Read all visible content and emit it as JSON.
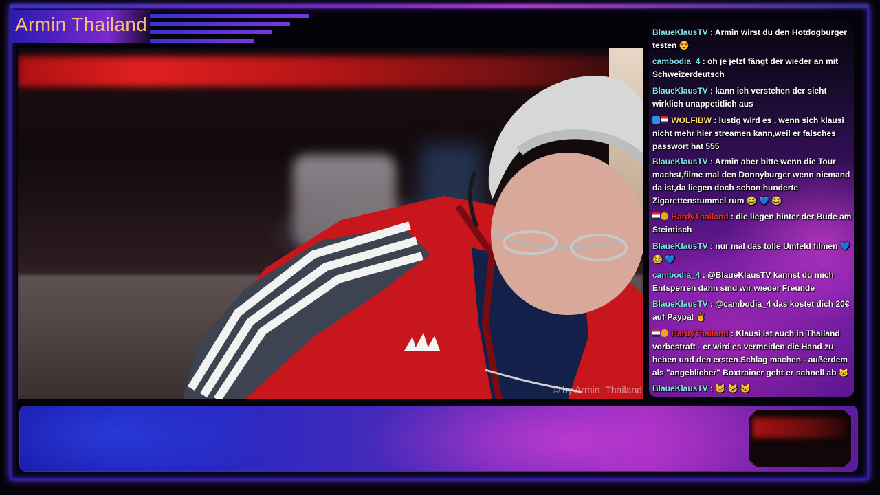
{
  "stream": {
    "title": "Armin Thailand",
    "watermark": "© by Armin_Thailand",
    "accent_colors": {
      "frame": "#2a1f9c",
      "title": "#f5c07a",
      "chat_bg": "#7a1fa8"
    }
  },
  "chat": {
    "messages": [
      {
        "user": "BlaueKlausTV",
        "user_color": "#7fe3e7",
        "badges": [],
        "text": "Armin wirst du den Hotdogburger testen",
        "emotes": "😍"
      },
      {
        "user": "cambodia_4",
        "user_color": "#7fe3e7",
        "badges": [],
        "text": "oh je jetzt fängt der wieder an mit Schweizerdeutsch",
        "emotes": ""
      },
      {
        "user": "BlaueKlausTV",
        "user_color": "#7fe3e7",
        "badges": [],
        "text": "kann ich verstehen der sieht wirklich unappetitlich aus",
        "emotes": ""
      },
      {
        "user": "WOLFIBW",
        "user_color": "#ffe36a",
        "badges": [
          "sub",
          "flag"
        ],
        "text": "lustig wird es , wenn sich klausi nicht mehr hier streamen kann,weil er falsches passwort hat 555",
        "emotes": ""
      },
      {
        "user": "BlaueKlausTV",
        "user_color": "#7fe3e7",
        "badges": [],
        "text": "Armin aber bitte wenn die Tour machst,filme mal den Donnyburger wenn niemand da ist,da liegen doch schon hunderte Zigarettenstummel rum",
        "emotes": "😂 💙 😂"
      },
      {
        "user": "HardyThailand",
        "user_color": "#e0302a",
        "badges": [
          "flag",
          "warn"
        ],
        "text": "die liegen hinter der Bude am Steintisch",
        "emotes": ""
      },
      {
        "user": "BlaueKlausTV",
        "user_color": "#7fe3e7",
        "badges": [],
        "text": "nur mal das tolle Umfeld filmen",
        "emotes": "💙 😂 💙"
      },
      {
        "user": "cambodia_4",
        "user_color": "#7fe3e7",
        "badges": [],
        "text": "@BlaueKlausTV kannst du mich Entsperren dann sind wir wieder Freunde",
        "emotes": ""
      },
      {
        "user": "BlaueKlausTV",
        "user_color": "#7fe3e7",
        "badges": [],
        "text": "@cambodia_4 das kostet dich 20€ auf Paypal",
        "emotes": "✌"
      },
      {
        "user": "HardyThailand",
        "user_color": "#e0302a",
        "badges": [
          "flag",
          "warn"
        ],
        "text": "Klausi ist auch in Thailand vorbestraft - er wird es vermeiden die Hand zu heben und den ersten Schlag machen - außerdem als \"angeblicher\" Boxtrainer geht er schnell ab",
        "emotes": "🐱"
      },
      {
        "user": "BlaueKlausTV",
        "user_color": "#7fe3e7",
        "badges": [],
        "text": "",
        "emotes": "🐱 🐱 🐱"
      }
    ]
  }
}
